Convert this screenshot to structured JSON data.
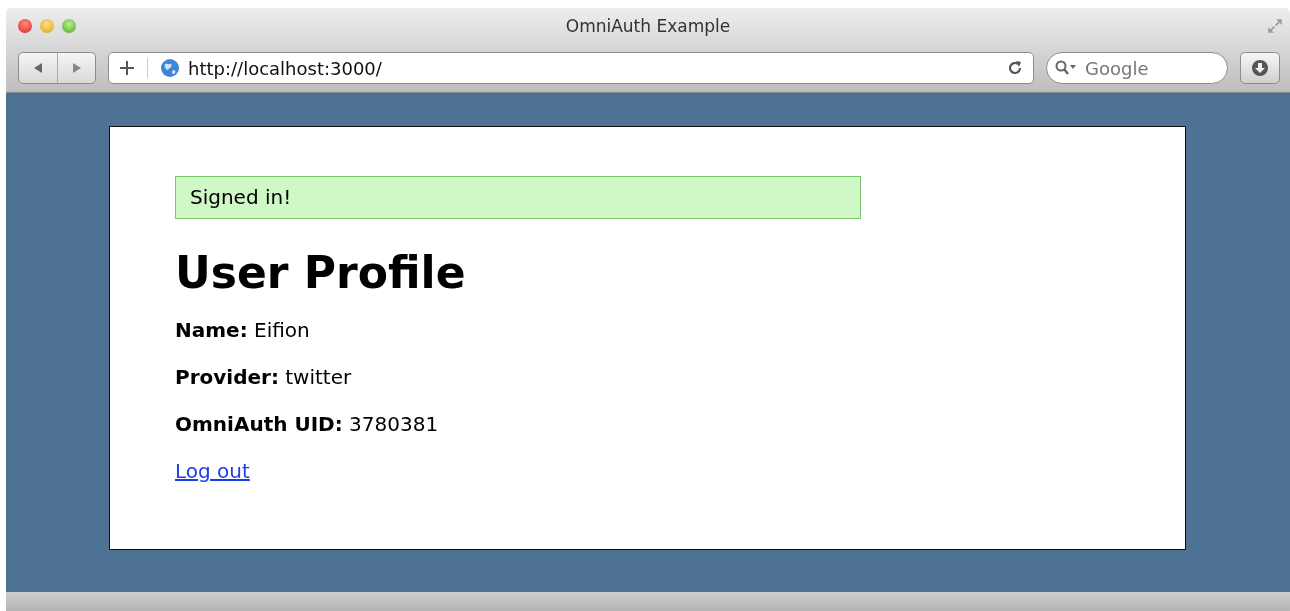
{
  "window": {
    "title": "OmniAuth Example"
  },
  "toolbar": {
    "address": "http://localhost:3000/",
    "search_placeholder": "Google"
  },
  "page": {
    "flash": "Signed in!",
    "heading": "User Profile",
    "fields": [
      "**Name:** Eifion",
      "**Provider:** twitter",
      "**OmniAuth UID:** 3780381"
    ],
    "link": "Log out"
  }
}
